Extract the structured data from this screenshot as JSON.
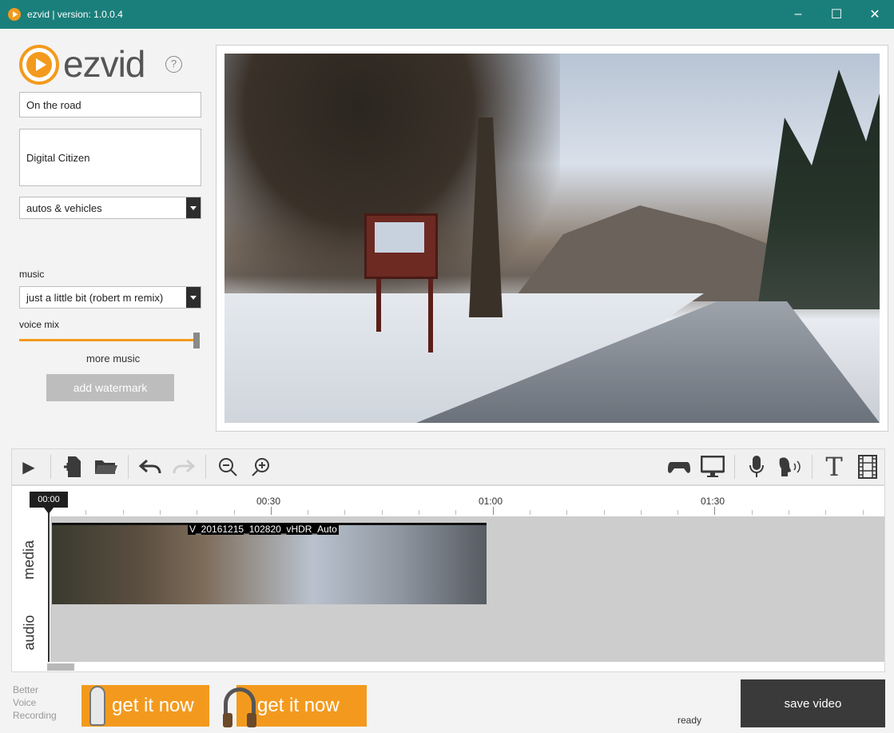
{
  "window": {
    "title": "ezvid | version: 1.0.0.4",
    "minimize": "–",
    "maximize": "☐",
    "close": "✕"
  },
  "logo": {
    "word": "ezvid",
    "help": "?"
  },
  "form": {
    "title_value": "On the road",
    "description_value": "Digital Citizen",
    "category_value": "autos & vehicles",
    "music_label": "music",
    "music_value": "just a little bit (robert m remix)",
    "voice_mix_label": "voice mix",
    "voice_mix_level": 1.0,
    "more_music": "more music",
    "add_watermark": "add watermark"
  },
  "toolbar": {
    "left": [
      {
        "name": "play-icon",
        "glyph": "▶"
      },
      {
        "name": "add-media-icon",
        "glyph": "✚"
      },
      {
        "name": "open-folder-icon",
        "glyph": "▬"
      },
      {
        "name": "undo-icon",
        "glyph": "↶"
      },
      {
        "name": "redo-icon",
        "glyph": "↷"
      },
      {
        "name": "zoom-out-icon",
        "glyph": "⊖"
      },
      {
        "name": "zoom-in-icon",
        "glyph": "⊕"
      }
    ],
    "right": [
      {
        "name": "gamepad-icon",
        "glyph": "🎮"
      },
      {
        "name": "screen-capture-icon",
        "glyph": "🖵"
      },
      {
        "name": "microphone-icon",
        "glyph": "🎙"
      },
      {
        "name": "speech-icon",
        "glyph": "🔊"
      },
      {
        "name": "text-icon",
        "glyph": "T"
      },
      {
        "name": "film-icon",
        "glyph": "🎞"
      }
    ]
  },
  "timeline": {
    "cursor_time": "00:00",
    "labels": [
      "00:30",
      "01:00",
      "01:30"
    ],
    "tracks": {
      "media": "media",
      "audio": "audio"
    },
    "clip_name": "V_20161215_102820_vHDR_Auto"
  },
  "bottom": {
    "better_voice": [
      "Better",
      "Voice",
      "Recording"
    ],
    "ad1": "get it now",
    "ad2": "get it now",
    "status": "ready",
    "save_video": "save video"
  },
  "colors": {
    "accent": "#f39a1e",
    "titlebar": "#1a7f7b",
    "save_button": "#3a3a3a"
  }
}
